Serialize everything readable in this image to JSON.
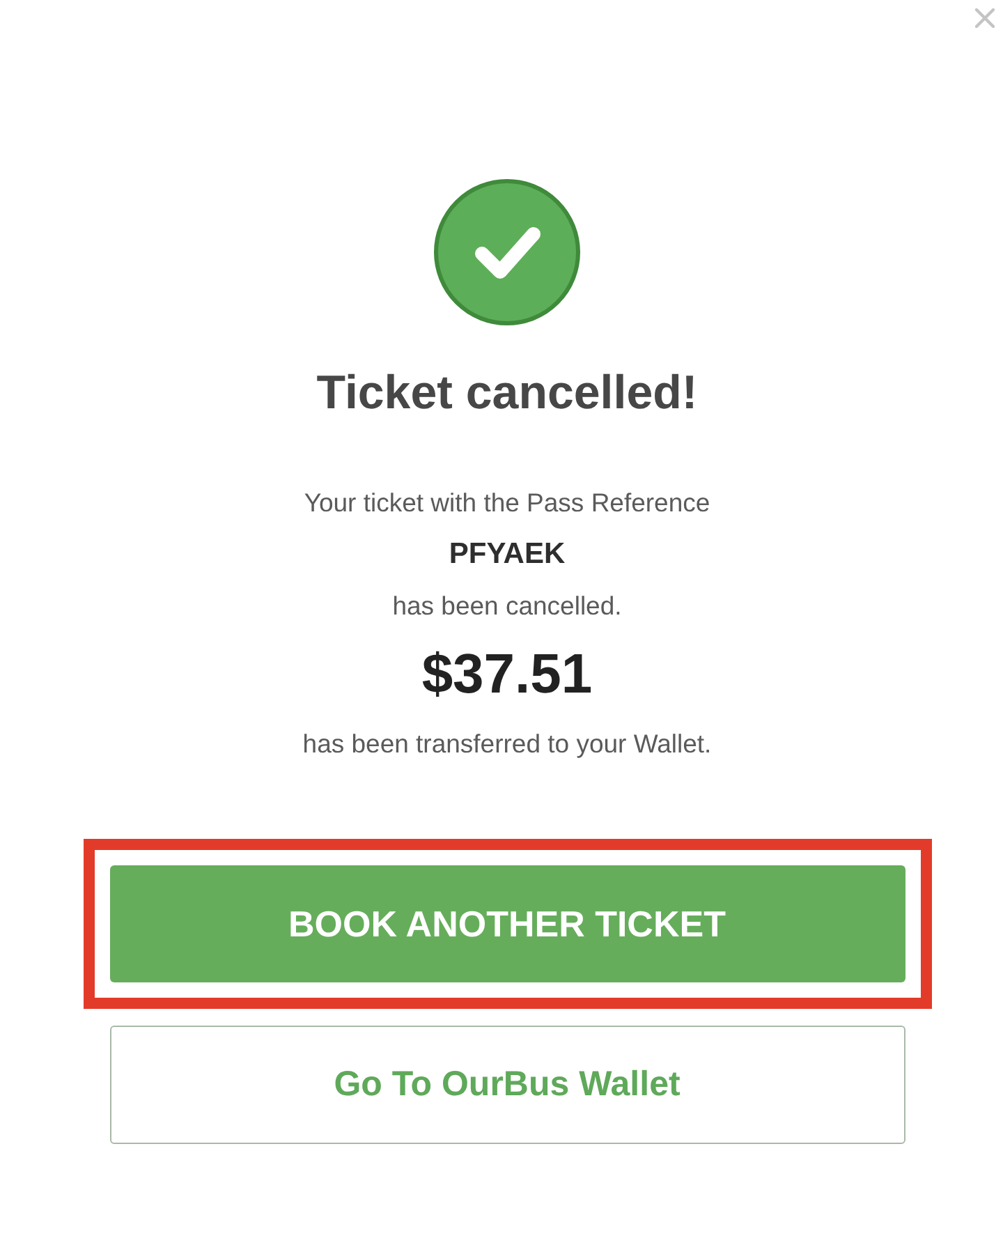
{
  "dialog": {
    "title": "Ticket cancelled!",
    "message": [
      {
        "kind": "text",
        "text": "Your ticket with the Pass Reference"
      },
      {
        "kind": "reference",
        "text": "PFYAEK"
      },
      {
        "kind": "text",
        "text": "has been cancelled."
      },
      {
        "kind": "amount",
        "text": "$37.51"
      },
      {
        "kind": "text",
        "text": "has been transferred to your Wallet."
      }
    ],
    "buttons": [
      {
        "kind": "primary",
        "label": "BOOK ANOTHER TICKET",
        "highlighted": true
      },
      {
        "kind": "secondary",
        "label": "Go To OurBus Wallet",
        "highlighted": false
      }
    ]
  }
}
